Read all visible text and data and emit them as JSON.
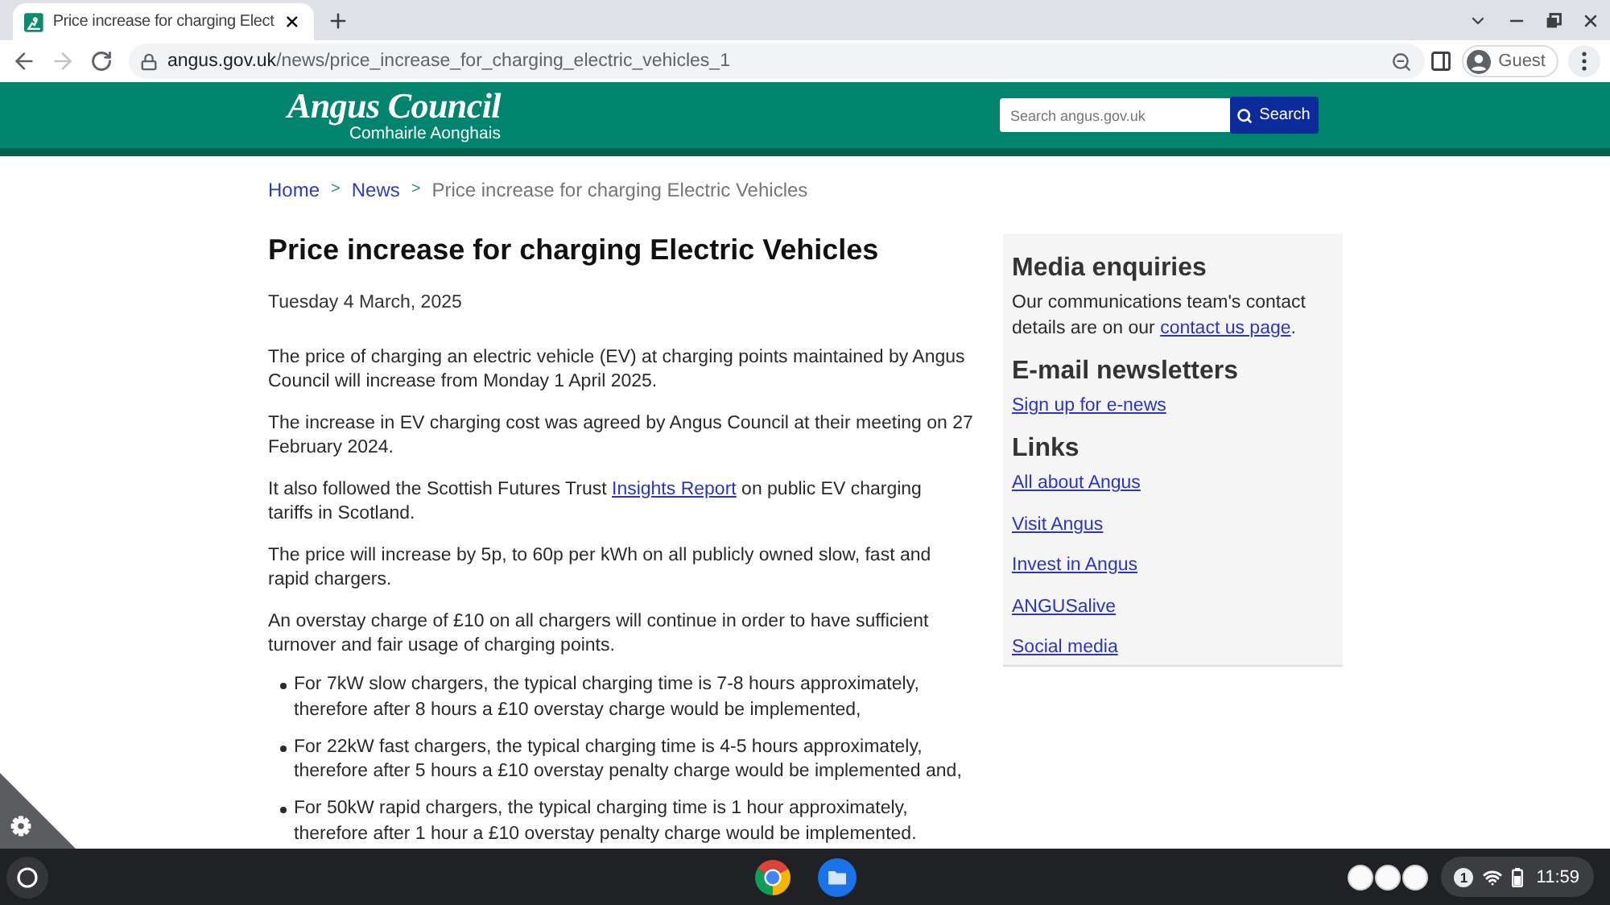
{
  "browser": {
    "tab": {
      "title": "Price increase for charging Elect"
    },
    "navigation": {
      "forward_disabled": true
    },
    "address": {
      "host": "angus.gov.uk",
      "path": "/news/price_increase_for_charging_electric_vehicles_1"
    },
    "profile": {
      "label": "Guest"
    }
  },
  "site_header": {
    "logo": {
      "name": "Angus Council",
      "subtitle": "Comhairle Aonghais"
    },
    "search": {
      "placeholder": "Search angus.gov.uk",
      "button": "Search"
    }
  },
  "breadcrumb": [
    {
      "label": "Home",
      "kind": "link",
      "separator": ">"
    },
    {
      "label": "News",
      "kind": "link",
      "separator": ">"
    },
    {
      "label": "Price increase for charging Electric Vehicles",
      "kind": "current"
    }
  ],
  "article": {
    "title": "Price increase for charging Electric Vehicles",
    "date": "Tuesday 4 March, 2025",
    "blocks": [
      {
        "kind": "paragraph",
        "parts": [
          {
            "kind": "text",
            "text": "The price of charging an electric vehicle (EV) at charging points maintained by Angus\nCouncil will increase from Monday 1 April 2025."
          }
        ]
      },
      {
        "kind": "paragraph",
        "parts": [
          {
            "kind": "text",
            "text": "The increase in EV charging cost was agreed by Angus Council at their meeting on 27\nFebruary 2024."
          }
        ]
      },
      {
        "kind": "paragraph",
        "parts": [
          {
            "kind": "text",
            "text": "It also followed the Scottish Futures Trust "
          },
          {
            "kind": "link",
            "text": "Insights Report"
          },
          {
            "kind": "text",
            "text": " on public EV charging\ntariffs in Scotland."
          }
        ]
      },
      {
        "kind": "paragraph",
        "parts": [
          {
            "kind": "text",
            "text": "The price will increase by 5p, to 60p per kWh on all publicly owned slow, fast and\nrapid chargers."
          }
        ]
      },
      {
        "kind": "paragraph",
        "parts": [
          {
            "kind": "text",
            "text": "An overstay charge of £10 on all chargers will continue in order to have sufficient\nturnover and fair usage of charging points."
          }
        ]
      },
      {
        "kind": "bullets",
        "items": [
          "For 7kW slow chargers, the typical charging time is 7-8 hours approximately,\ntherefore after 8 hours a £10 overstay charge would be implemented,",
          "For 22kW fast chargers, the typical charging time is 4-5 hours approximately,\ntherefore after 5 hours a £10 overstay penalty charge would be implemented and,",
          "For 50kW rapid chargers, the typical charging time is 1 hour approximately,\ntherefore after 1 hour a £10 overstay penalty charge would be implemented."
        ]
      }
    ]
  },
  "sidebar": {
    "sections": [
      {
        "heading": "Media enquiries",
        "kind": "text",
        "parts": [
          {
            "kind": "text",
            "text": "Our communications team's contact\ndetails are on our "
          },
          {
            "kind": "link",
            "text": "contact us page"
          },
          {
            "kind": "text",
            "text": "."
          }
        ]
      },
      {
        "heading": "E-mail newsletters",
        "kind": "links",
        "links": [
          "Sign up for e-news"
        ]
      },
      {
        "heading": "Links",
        "kind": "links",
        "links": [
          "All about Angus",
          "Visit Angus",
          "Invest in Angus",
          "ANGUSalive",
          "Social media"
        ]
      }
    ]
  },
  "shelf": {
    "notification_count": "1",
    "time": "11:59"
  }
}
